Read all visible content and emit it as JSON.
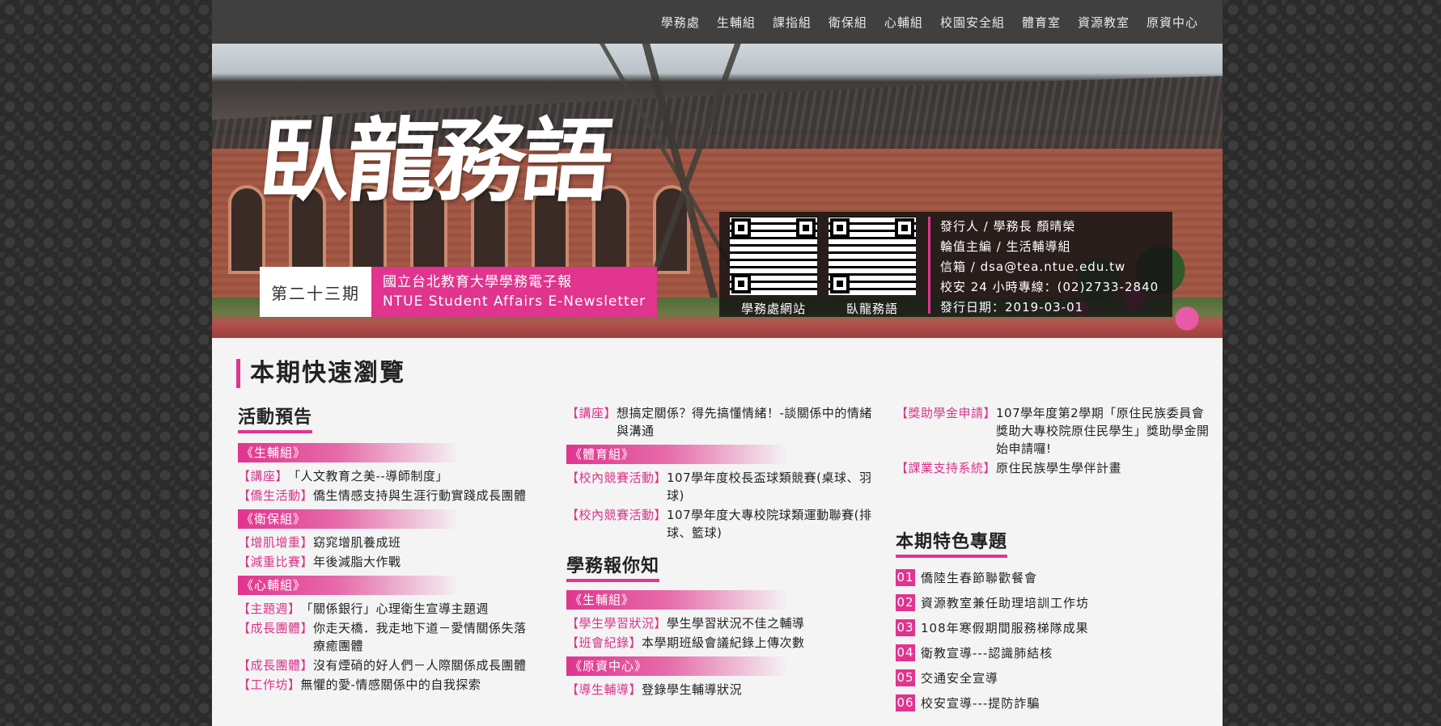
{
  "nav": [
    "學務處",
    "生輔組",
    "課指組",
    "衛保組",
    "心輔組",
    "校園安全組",
    "體育室",
    "資源教室",
    "原資中心"
  ],
  "banner": {
    "title": "臥龍務語",
    "issue": "第二十三期",
    "subtitle_zh": "國立台北教育大學學務電子報",
    "subtitle_en": "NTUE Student Affairs E-Newsletter",
    "qr1_label": "學務處網站",
    "qr2_label": "臥龍務語",
    "info": [
      "發行人 / 學務長 顏晴榮",
      "輪值主編 / 生活輔導組",
      "信箱 / dsa@tea.ntue.edu.tw",
      "校安 24 小時專線：(02)2733-2840",
      "發行日期：2019-03-01"
    ]
  },
  "quick_title": "本期快速瀏覽",
  "col1": {
    "heading": "活動預告",
    "groups": [
      {
        "name": "《生輔組》",
        "items": [
          {
            "tag": "【講座】",
            "text": "「人文教育之美--導師制度」"
          },
          {
            "tag": "【僑生活動】",
            "text": "僑生情感支持與生涯行動實踐成長團體"
          }
        ]
      },
      {
        "name": "《衛保組》",
        "items": [
          {
            "tag": "【增肌增重】",
            "text": "窈窕增肌養成班"
          },
          {
            "tag": "【減重比賽】",
            "text": "年後減脂大作戰"
          }
        ]
      },
      {
        "name": "《心輔組》",
        "items": [
          {
            "tag": "【主題週】",
            "text": "「關係銀行」心理衛生宣導主題週"
          },
          {
            "tag": "【成長團體】",
            "text": "你走天橋．我走地下道－愛情關係失落療癒團體"
          },
          {
            "tag": "【成長團體】",
            "text": "沒有煙硝的好人們－人際關係成長團體"
          },
          {
            "tag": "【工作坊】",
            "text": "無懼的愛-情感關係中的自我探索"
          }
        ]
      }
    ]
  },
  "col2": {
    "top_items": [
      {
        "tag": "【講座】",
        "text": "想搞定關係？得先搞懂情緒！-談關係中的情緒與溝通"
      }
    ],
    "groups_a": [
      {
        "name": "《體育組》",
        "items": [
          {
            "tag": "【校內競賽活動】",
            "text": "107學年度校長盃球類競賽(桌球、羽球)"
          },
          {
            "tag": "【校內競賽活動】",
            "text": "107學年度大專校院球類運動聯賽(排球、籃球)"
          }
        ]
      }
    ],
    "heading": "學務報你知",
    "groups_b": [
      {
        "name": "《生輔組》",
        "items": [
          {
            "tag": "【學生學習狀況】",
            "text": "學生學習狀況不佳之輔導"
          },
          {
            "tag": "【班會紀錄】",
            "text": "本學期班級會議紀錄上傳次數"
          }
        ]
      },
      {
        "name": "《原資中心》",
        "items": [
          {
            "tag": "【導生輔導】",
            "text": "登錄學生輔導狀況"
          }
        ]
      }
    ]
  },
  "col3": {
    "top_items": [
      {
        "tag": "【獎助學金申請】",
        "text": "107學年度第2學期「原住民族委員會獎助大專校院原住民學生」獎助學金開始申請囉!"
      },
      {
        "tag": "【課業支持系統】",
        "text": "原住民族學生學伴計畫"
      }
    ],
    "heading": "本期特色專題",
    "features": [
      {
        "num": "01",
        "text": "僑陸生春節聯歡餐會"
      },
      {
        "num": "02",
        "text": "資源教室兼任助理培訓工作坊"
      },
      {
        "num": "03",
        "text": "108年寒假期間服務梯隊成果"
      },
      {
        "num": "04",
        "text": "衛教宣導---認識肺結核"
      },
      {
        "num": "05",
        "text": "交通安全宣導"
      },
      {
        "num": "06",
        "text": "校安宣導---提防詐騙"
      }
    ]
  }
}
